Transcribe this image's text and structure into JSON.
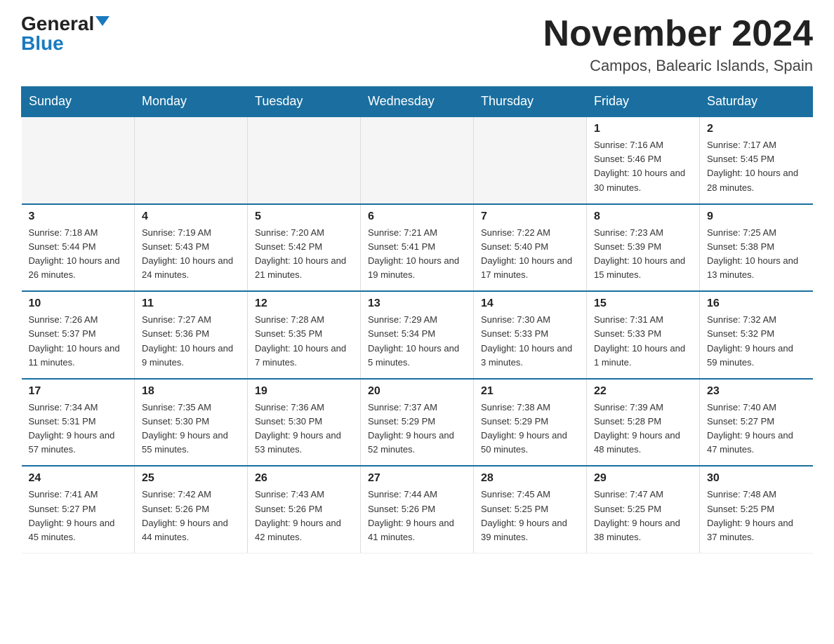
{
  "logo": {
    "general": "General",
    "blue": "Blue"
  },
  "title": "November 2024",
  "location": "Campos, Balearic Islands, Spain",
  "days_of_week": [
    "Sunday",
    "Monday",
    "Tuesday",
    "Wednesday",
    "Thursday",
    "Friday",
    "Saturday"
  ],
  "weeks": [
    [
      {
        "day": "",
        "info": ""
      },
      {
        "day": "",
        "info": ""
      },
      {
        "day": "",
        "info": ""
      },
      {
        "day": "",
        "info": ""
      },
      {
        "day": "",
        "info": ""
      },
      {
        "day": "1",
        "info": "Sunrise: 7:16 AM\nSunset: 5:46 PM\nDaylight: 10 hours and 30 minutes."
      },
      {
        "day": "2",
        "info": "Sunrise: 7:17 AM\nSunset: 5:45 PM\nDaylight: 10 hours and 28 minutes."
      }
    ],
    [
      {
        "day": "3",
        "info": "Sunrise: 7:18 AM\nSunset: 5:44 PM\nDaylight: 10 hours and 26 minutes."
      },
      {
        "day": "4",
        "info": "Sunrise: 7:19 AM\nSunset: 5:43 PM\nDaylight: 10 hours and 24 minutes."
      },
      {
        "day": "5",
        "info": "Sunrise: 7:20 AM\nSunset: 5:42 PM\nDaylight: 10 hours and 21 minutes."
      },
      {
        "day": "6",
        "info": "Sunrise: 7:21 AM\nSunset: 5:41 PM\nDaylight: 10 hours and 19 minutes."
      },
      {
        "day": "7",
        "info": "Sunrise: 7:22 AM\nSunset: 5:40 PM\nDaylight: 10 hours and 17 minutes."
      },
      {
        "day": "8",
        "info": "Sunrise: 7:23 AM\nSunset: 5:39 PM\nDaylight: 10 hours and 15 minutes."
      },
      {
        "day": "9",
        "info": "Sunrise: 7:25 AM\nSunset: 5:38 PM\nDaylight: 10 hours and 13 minutes."
      }
    ],
    [
      {
        "day": "10",
        "info": "Sunrise: 7:26 AM\nSunset: 5:37 PM\nDaylight: 10 hours and 11 minutes."
      },
      {
        "day": "11",
        "info": "Sunrise: 7:27 AM\nSunset: 5:36 PM\nDaylight: 10 hours and 9 minutes."
      },
      {
        "day": "12",
        "info": "Sunrise: 7:28 AM\nSunset: 5:35 PM\nDaylight: 10 hours and 7 minutes."
      },
      {
        "day": "13",
        "info": "Sunrise: 7:29 AM\nSunset: 5:34 PM\nDaylight: 10 hours and 5 minutes."
      },
      {
        "day": "14",
        "info": "Sunrise: 7:30 AM\nSunset: 5:33 PM\nDaylight: 10 hours and 3 minutes."
      },
      {
        "day": "15",
        "info": "Sunrise: 7:31 AM\nSunset: 5:33 PM\nDaylight: 10 hours and 1 minute."
      },
      {
        "day": "16",
        "info": "Sunrise: 7:32 AM\nSunset: 5:32 PM\nDaylight: 9 hours and 59 minutes."
      }
    ],
    [
      {
        "day": "17",
        "info": "Sunrise: 7:34 AM\nSunset: 5:31 PM\nDaylight: 9 hours and 57 minutes."
      },
      {
        "day": "18",
        "info": "Sunrise: 7:35 AM\nSunset: 5:30 PM\nDaylight: 9 hours and 55 minutes."
      },
      {
        "day": "19",
        "info": "Sunrise: 7:36 AM\nSunset: 5:30 PM\nDaylight: 9 hours and 53 minutes."
      },
      {
        "day": "20",
        "info": "Sunrise: 7:37 AM\nSunset: 5:29 PM\nDaylight: 9 hours and 52 minutes."
      },
      {
        "day": "21",
        "info": "Sunrise: 7:38 AM\nSunset: 5:29 PM\nDaylight: 9 hours and 50 minutes."
      },
      {
        "day": "22",
        "info": "Sunrise: 7:39 AM\nSunset: 5:28 PM\nDaylight: 9 hours and 48 minutes."
      },
      {
        "day": "23",
        "info": "Sunrise: 7:40 AM\nSunset: 5:27 PM\nDaylight: 9 hours and 47 minutes."
      }
    ],
    [
      {
        "day": "24",
        "info": "Sunrise: 7:41 AM\nSunset: 5:27 PM\nDaylight: 9 hours and 45 minutes."
      },
      {
        "day": "25",
        "info": "Sunrise: 7:42 AM\nSunset: 5:26 PM\nDaylight: 9 hours and 44 minutes."
      },
      {
        "day": "26",
        "info": "Sunrise: 7:43 AM\nSunset: 5:26 PM\nDaylight: 9 hours and 42 minutes."
      },
      {
        "day": "27",
        "info": "Sunrise: 7:44 AM\nSunset: 5:26 PM\nDaylight: 9 hours and 41 minutes."
      },
      {
        "day": "28",
        "info": "Sunrise: 7:45 AM\nSunset: 5:25 PM\nDaylight: 9 hours and 39 minutes."
      },
      {
        "day": "29",
        "info": "Sunrise: 7:47 AM\nSunset: 5:25 PM\nDaylight: 9 hours and 38 minutes."
      },
      {
        "day": "30",
        "info": "Sunrise: 7:48 AM\nSunset: 5:25 PM\nDaylight: 9 hours and 37 minutes."
      }
    ]
  ]
}
